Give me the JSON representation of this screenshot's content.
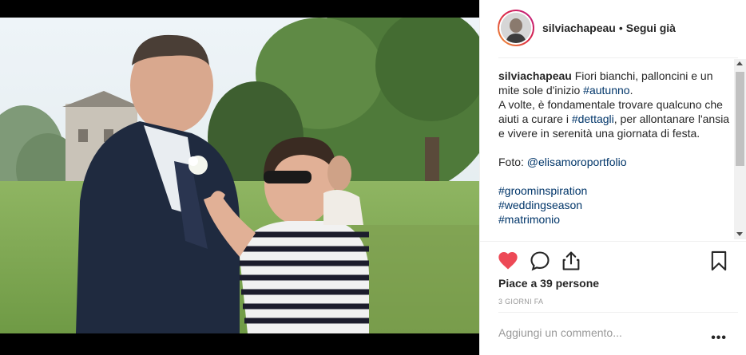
{
  "post": {
    "username": "silviachapeau",
    "follow_status": "Segui già",
    "separator": "•"
  },
  "caption": {
    "username": "silviachapeau",
    "text1": " Fiori bianchi, palloncini e un mite sole d'inizio ",
    "tag_autunno": "#autunno",
    "text2": ".",
    "text3": "A volte, è fondamentale trovare qualcuno che aiuti a curare i ",
    "tag_dettagli": "#dettagli",
    "text4": ", per allontanare l'ansia e vivere in serenità una giornata di festa.",
    "foto_label": "Foto: ",
    "photographer": "@elisamoroportfolio",
    "hashtags": [
      "#groominspiration",
      "#weddingseason",
      "#matrimonio"
    ]
  },
  "engagement": {
    "likes": "Piace a 39 persone",
    "time": "3 GIORNI FA"
  },
  "comment": {
    "placeholder": "Aggiungi un commento...",
    "more": "•••"
  },
  "icons": {
    "like": "heart-icon",
    "comment": "comment-icon",
    "share": "share-icon",
    "save": "bookmark-icon"
  },
  "colors": {
    "like": "#ed4956",
    "hashtag": "#003569",
    "muted": "#999999"
  }
}
